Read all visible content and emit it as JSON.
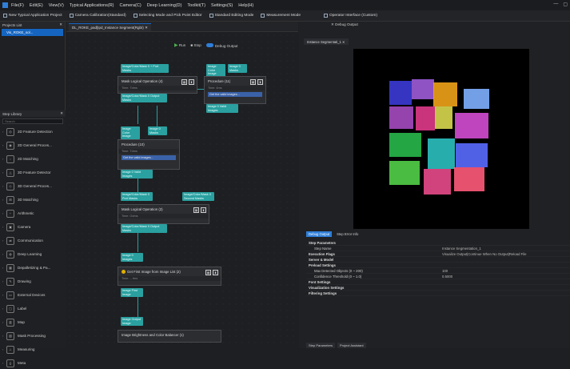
{
  "menubar": {
    "items": [
      "File(F)",
      "Edit(E)",
      "View(V)",
      "Typical Applications(R)",
      "Camera(C)",
      "Deep Learning(D)",
      "Toolkit(T)",
      "Settings(S)",
      "Help(H)"
    ]
  },
  "toolbar": {
    "items": [
      "New Typical Application Project",
      "Camera Calibration(Standard)",
      "Selecting Mode and Pick Point Editor",
      "Standard Editing Mode",
      "Measurement Mode",
      "Operator Interface (Custom)"
    ]
  },
  "projects": {
    "header": "Projects List",
    "item": "Vis_ROKE_sol..."
  },
  "canvas": {
    "tab": "DL_ROKE_pad[Ipd_Instance Segment(RgbI)",
    "run": "Run",
    "stop": "Stop",
    "debug": "Debug Output"
  },
  "steplib": {
    "header": "Step Library",
    "search": "Search",
    "items": [
      "2D Feature Detection",
      "2D General Proces...",
      "2D Matching",
      "3D Feature Detector",
      "3D General Proces...",
      "3D Matching",
      "Arithmetic",
      "Camera",
      "Communication",
      "Deep Learning",
      "Depalletizing & Pa...",
      "Drawing",
      "External Devices",
      "Label",
      "Map",
      "Mask Processing",
      "Measuring",
      "Meta"
    ]
  },
  "nodes": {
    "n1": {
      "title": "Mask Logical Operation (4)",
      "sub": "Time: Tdms"
    },
    "n2": {
      "title": "Procedure (11)",
      "sub": "Time: 4ms",
      "bar": "Get the valid images..."
    },
    "n3": {
      "title": "Procedure (10)",
      "sub": "Time: Tdms",
      "bar": "Get the valid images..."
    },
    "n4": {
      "title": "Mask Logical Operation (2)",
      "sub": "Time: Odms"
    },
    "n5": {
      "title": "Get First Image from Image List (2)",
      "sub": "Time: -- fms"
    },
    "n6": {
      "title": "Image Brightness and Color Balancer (1)",
      "sub": ""
    }
  },
  "ports": {
    "p1": "Image/Color/Mask 0 + Port Masks",
    "p2": "Image Color Image",
    "p3": "Image 0 Masks",
    "p4": "Image/Color/Mask 0 Output Masks",
    "p5": "Image 0 Valid Images",
    "p6": "Image Color Image",
    "p7": "Image 0 Masks",
    "p8": "Image 0 Valid Images",
    "p9": "Image/Color/Mask 0 Port Masks",
    "p10": "Image/Color/Mask 0 Second Masks",
    "p11": "Image/Color/Mask 0 Output Masks",
    "p12": "Image 0 Images",
    "p13": "Image First Image",
    "p14": "Image Output Image"
  },
  "right": {
    "title": "Debug Output",
    "viewTab": "Instance Segmentati_1",
    "paramTabs": [
      "Debug Output",
      "Step Error Info"
    ],
    "params": [
      {
        "k": "Step Parameters",
        "v": "",
        "sec": true
      },
      {
        "k": "Step Name",
        "v": "Instance Segmentation_1",
        "sec": false
      },
      {
        "k": "Execution Flags",
        "v": "Visualize Output|Continue When No Output|Reload File",
        "sec": true
      },
      {
        "k": "Server & Model",
        "v": "",
        "sec": true
      },
      {
        "k": "Preload Settings",
        "v": "",
        "sec": true
      },
      {
        "k": "Max Detected Objects (0 ~ 200)",
        "v": "100",
        "sec": false
      },
      {
        "k": "Confidence Threshold (0 ~ 1.0)",
        "v": "0.5000",
        "sec": false
      },
      {
        "k": "Font Settings",
        "v": "",
        "sec": true
      },
      {
        "k": "Visualization Settings",
        "v": "",
        "sec": true
      },
      {
        "k": "Filtering Settings",
        "v": "",
        "sec": true
      }
    ],
    "bottomTabs": [
      "Step Parameters",
      "Project Assistant"
    ]
  },
  "colors": {
    "accent": "#1565c0",
    "port": "#2aa0a0"
  }
}
